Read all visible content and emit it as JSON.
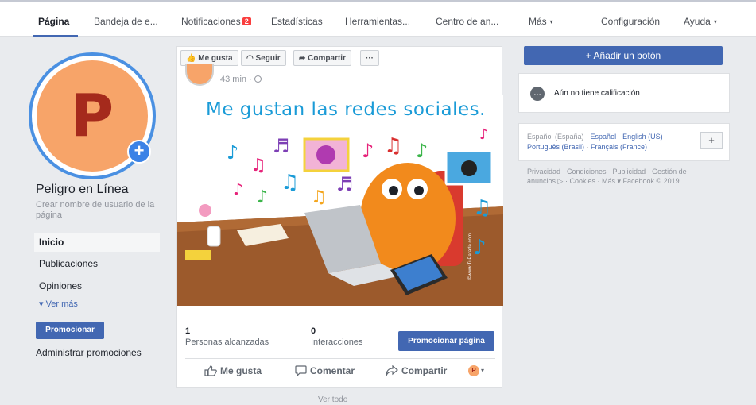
{
  "nav": {
    "items": [
      {
        "label": "Página",
        "active": true
      },
      {
        "label": "Bandeja de e..."
      },
      {
        "label": "Notificaciones",
        "badge": "2"
      },
      {
        "label": "Estadísticas"
      },
      {
        "label": "Herramientas..."
      },
      {
        "label": "Centro de an..."
      },
      {
        "label": "Más",
        "caret": "▾"
      },
      {
        "label": "Configuración"
      },
      {
        "label": "Ayuda",
        "caret": "▾"
      }
    ]
  },
  "profile": {
    "avatar_letter": "P",
    "avatar_color": "#f7a469",
    "ring_color": "#4a90e2",
    "add_icon": "plus-circle-icon",
    "name": "Peligro en Línea",
    "username_link": "Crear nombre de usuario de la página"
  },
  "left_nav": {
    "items": [
      {
        "label": "Inicio",
        "active": true
      },
      {
        "label": "Publicaciones"
      },
      {
        "label": "Opiniones"
      }
    ],
    "more": "▾ Ver más",
    "promote_button": "Promocionar",
    "manage_promotions": "Administrar promociones"
  },
  "action_bar": {
    "like": "Me gusta",
    "follow": "Seguir",
    "share": "Compartir",
    "more": "···"
  },
  "post": {
    "time": "43 min ·",
    "image_caption": "Me gustan las redes sociales.",
    "image_credit": "©www.TuParada.com",
    "stats": [
      {
        "value": "1",
        "label": "Personas alcanzadas"
      },
      {
        "value": "0",
        "label": "Interacciones"
      }
    ],
    "promote_page_button": "Promocionar página",
    "reactions": {
      "like": "Me gusta",
      "comment": "Comentar",
      "share": "Compartir",
      "avatar_letter": "P",
      "caret": "▾"
    },
    "below_text": "Ver todo"
  },
  "right": {
    "add_button": "+ Añadir un botón",
    "rating": "Aún no tiene calificación",
    "languages": {
      "current": "Español (España)",
      "others": [
        "Español",
        "English (US)",
        "Português (Brasil)",
        "Français (France)"
      ],
      "plus": "+"
    },
    "footer": "Privacidad · Condiciones · Publicidad · Gestión de anuncios ▷ · Cookies · Más ▾ Facebook © 2019"
  },
  "colors": {
    "brand": "#4267b2",
    "badge": "#fa3e3e",
    "background": "#e9ebee"
  }
}
